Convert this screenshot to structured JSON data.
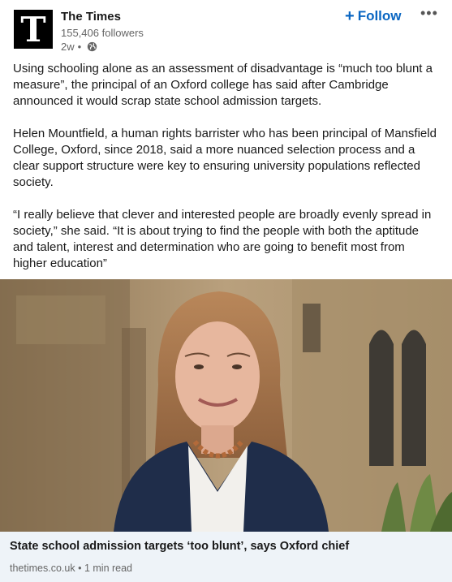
{
  "post": {
    "org_name": "The Times",
    "logo_letter": "T",
    "followers": "155,406 followers",
    "time_ago": "2w",
    "separator": "•",
    "follow_label": "Follow",
    "follow_icon": "+",
    "more_label": "•••",
    "paragraphs": [
      "Using schooling alone as an assessment of disadvantage is “much too blunt a measure”, the principal of an Oxford college has said after Cambridge announced it would scrap state school admission targets.",
      "Helen Mountfield, a human rights barrister who has been principal of Mansfield College, Oxford, since 2018, said a more nuanced selection process and a clear support structure were key to ensuring university populations reflected society.",
      "“I really believe that clever and interested people are broadly evenly spread in society,” she said. “It is about trying to find the people with both the aptitude and talent, interest and determination who are going to benefit most from higher education”"
    ]
  },
  "article": {
    "title": "State school admission targets ‘too blunt’, says Oxford chief",
    "source": "thetimes.co.uk",
    "dot": "•",
    "read_time": "1 min read"
  },
  "icons": {
    "globe": "globe-icon",
    "logo": "the-times-logo",
    "more": "ellipsis-icon",
    "follow": "plus-icon"
  },
  "colors": {
    "accent": "#0a66c2",
    "footer_bg": "#eef3f8",
    "muted": "#666666"
  }
}
